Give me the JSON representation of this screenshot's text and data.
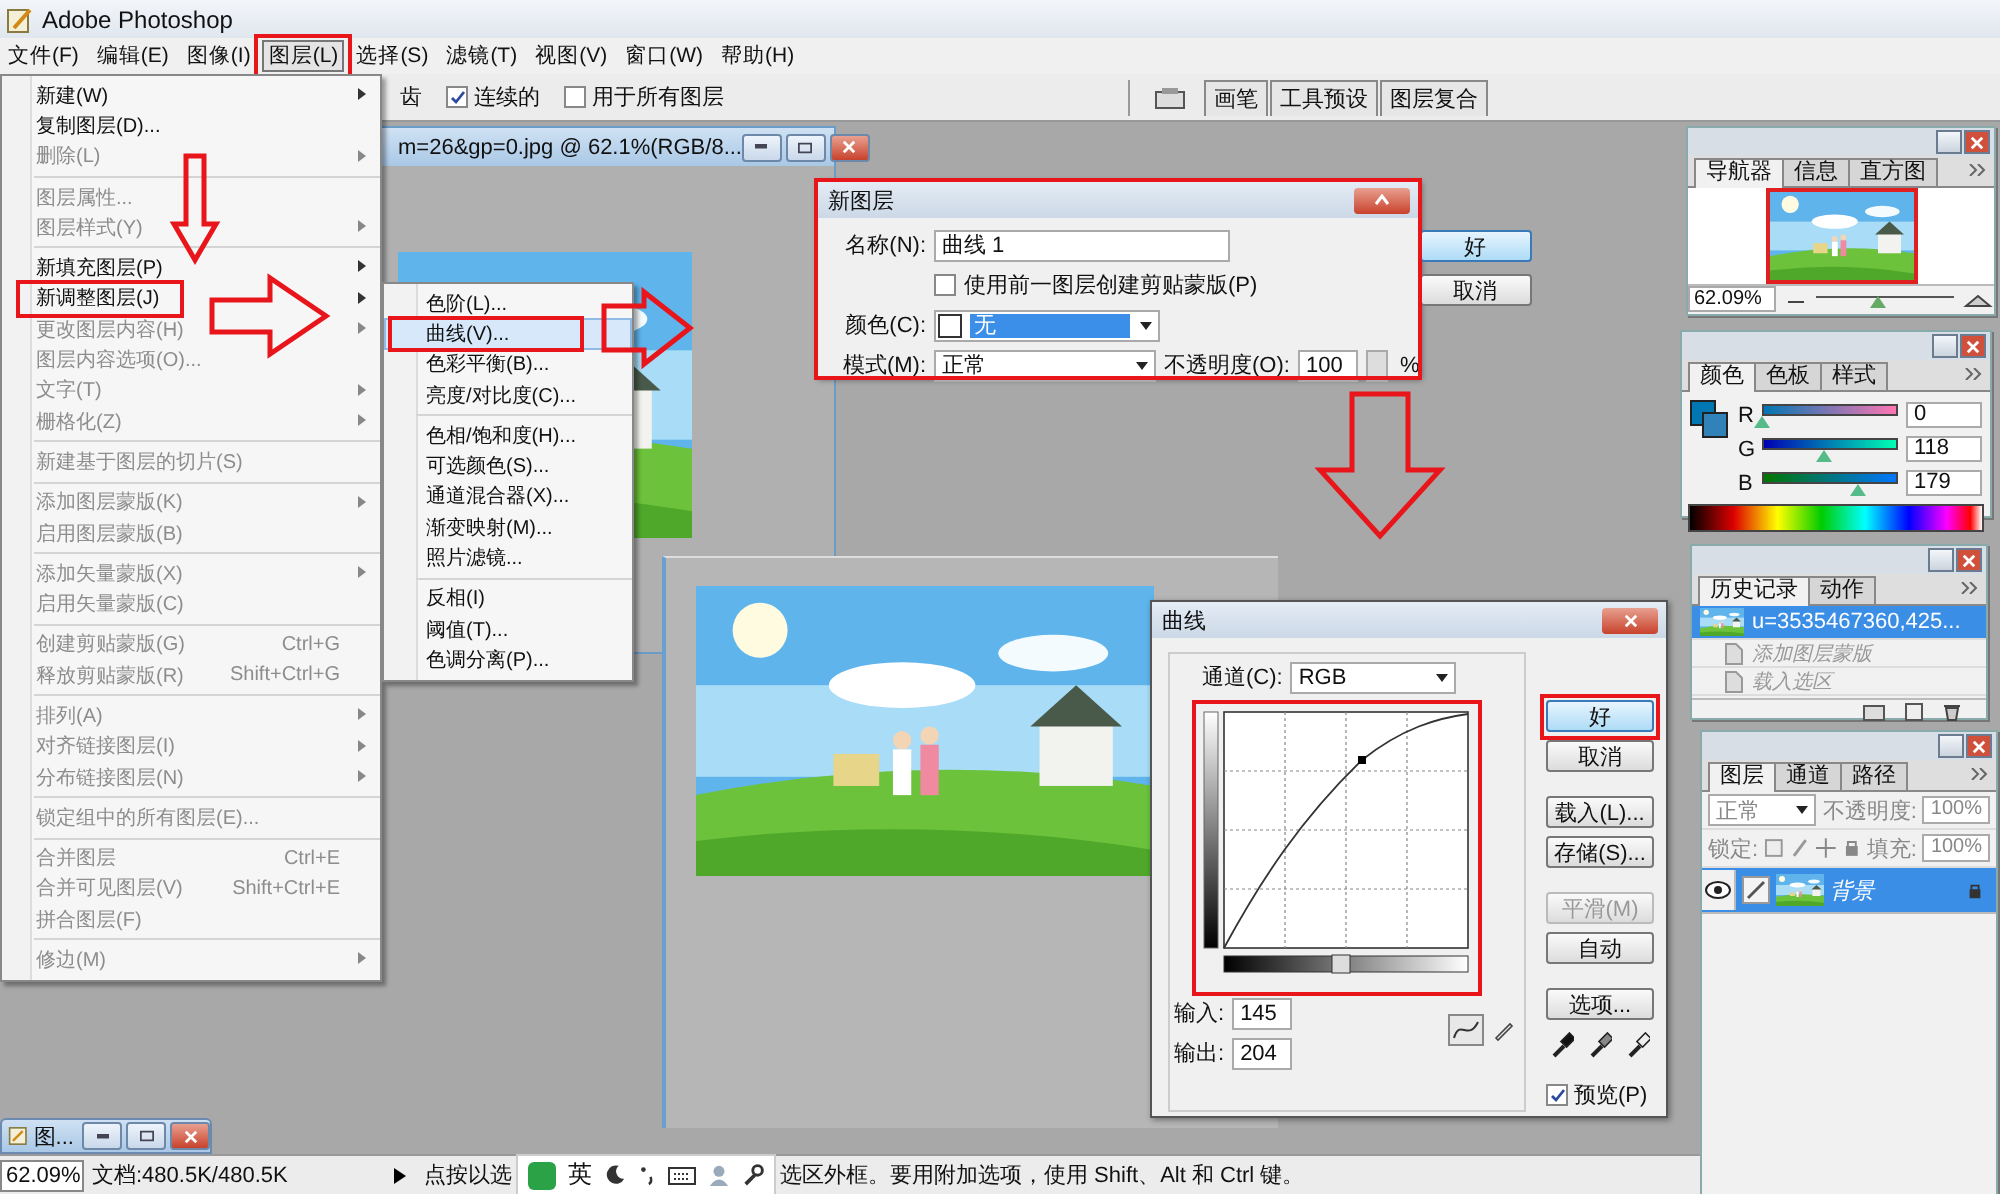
{
  "app_title": "Adobe Photoshop",
  "menu_bar": [
    {
      "label": "文件(F)",
      "selected": false,
      "marked": false
    },
    {
      "label": "编辑(E)",
      "selected": false,
      "marked": false
    },
    {
      "label": "图像(I)",
      "selected": false,
      "marked": false
    },
    {
      "label": "图层(L)",
      "selected": true,
      "marked": true
    },
    {
      "label": "选择(S)",
      "selected": false,
      "marked": false
    },
    {
      "label": "滤镜(T)",
      "selected": false,
      "marked": false
    },
    {
      "label": "视图(V)",
      "selected": false,
      "marked": false
    },
    {
      "label": "窗口(W)",
      "selected": false,
      "marked": false
    },
    {
      "label": "帮助(H)",
      "selected": false,
      "marked": false
    }
  ],
  "options_bar": {
    "cut_text": "齿",
    "checkboxes": [
      {
        "label": "连续的",
        "checked": true
      },
      {
        "label": "用于所有图层",
        "checked": false
      }
    ]
  },
  "palette_well": {
    "tabs": [
      "画笔",
      "工具预设",
      "图层复合"
    ]
  },
  "layer_menu": {
    "groups": [
      [
        {
          "label": "新建(W)",
          "disabled": false,
          "submenu": true,
          "marked": false
        },
        {
          "label": "复制图层(D)...",
          "disabled": false,
          "submenu": false,
          "marked": false
        },
        {
          "label": "删除(L)",
          "disabled": true,
          "submenu": true,
          "marked": false
        }
      ],
      [
        {
          "label": "图层属性...",
          "disabled": true,
          "submenu": false,
          "marked": false
        },
        {
          "label": "图层样式(Y)",
          "disabled": true,
          "submenu": true,
          "marked": false
        }
      ],
      [
        {
          "label": "新填充图层(P)",
          "disabled": false,
          "submenu": true,
          "marked": false
        },
        {
          "label": "新调整图层(J)",
          "disabled": false,
          "submenu": true,
          "marked": true
        },
        {
          "label": "更改图层内容(H)",
          "disabled": true,
          "submenu": true,
          "marked": false
        },
        {
          "label": "图层内容选项(O)...",
          "disabled": true,
          "submenu": false,
          "marked": false
        },
        {
          "label": "文字(T)",
          "disabled": true,
          "submenu": true,
          "marked": false
        },
        {
          "label": "栅格化(Z)",
          "disabled": true,
          "submenu": true,
          "marked": false
        }
      ],
      [
        {
          "label": "新建基于图层的切片(S)",
          "disabled": true,
          "submenu": false,
          "marked": false
        }
      ],
      [
        {
          "label": "添加图层蒙版(K)",
          "disabled": true,
          "submenu": true,
          "marked": false
        },
        {
          "label": "启用图层蒙版(B)",
          "disabled": true,
          "submenu": false,
          "marked": false
        }
      ],
      [
        {
          "label": "添加矢量蒙版(X)",
          "disabled": true,
          "submenu": true,
          "marked": false
        },
        {
          "label": "启用矢量蒙版(C)",
          "disabled": true,
          "submenu": false,
          "marked": false
        }
      ],
      [
        {
          "label": "创建剪贴蒙版(G)",
          "shortcut": "Ctrl+G",
          "disabled": true,
          "submenu": false,
          "marked": false
        },
        {
          "label": "释放剪贴蒙版(R)",
          "shortcut": "Shift+Ctrl+G",
          "disabled": true,
          "submenu": false,
          "marked": false
        }
      ],
      [
        {
          "label": "排列(A)",
          "disabled": true,
          "submenu": true,
          "marked": false
        },
        {
          "label": "对齐链接图层(I)",
          "disabled": true,
          "submenu": true,
          "marked": false
        },
        {
          "label": "分布链接图层(N)",
          "disabled": true,
          "submenu": true,
          "marked": false
        }
      ],
      [
        {
          "label": "锁定组中的所有图层(E)...",
          "disabled": true,
          "submenu": false,
          "marked": false
        }
      ],
      [
        {
          "label": "合并图层",
          "shortcut": "Ctrl+E",
          "disabled": true,
          "submenu": false,
          "marked": false
        },
        {
          "label": "合并可见图层(V)",
          "shortcut": "Shift+Ctrl+E",
          "disabled": true,
          "submenu": false,
          "marked": false
        },
        {
          "label": "拼合图层(F)",
          "disabled": true,
          "submenu": false,
          "marked": false
        }
      ],
      [
        {
          "label": "修边(M)",
          "disabled": true,
          "submenu": true,
          "marked": false
        }
      ]
    ]
  },
  "adjustment_submenu": {
    "groups": [
      [
        {
          "label": "色阶(L)...",
          "selected": false,
          "marked": false
        },
        {
          "label": "曲线(V)...",
          "selected": true,
          "marked": true
        },
        {
          "label": "色彩平衡(B)...",
          "selected": false,
          "marked": false
        },
        {
          "label": "亮度/对比度(C)...",
          "selected": false,
          "marked": false
        }
      ],
      [
        {
          "label": "色相/饱和度(H)...",
          "selected": false,
          "marked": false
        },
        {
          "label": "可选颜色(S)...",
          "selected": false,
          "marked": false
        },
        {
          "label": "通道混合器(X)...",
          "selected": false,
          "marked": false
        },
        {
          "label": "渐变映射(M)...",
          "selected": false,
          "marked": false
        },
        {
          "label": "照片滤镜...",
          "selected": false,
          "marked": false
        }
      ],
      [
        {
          "label": "反相(I)",
          "selected": false,
          "marked": false
        },
        {
          "label": "阈值(T)...",
          "selected": false,
          "marked": false
        },
        {
          "label": "色调分离(P)...",
          "selected": false,
          "marked": false
        }
      ]
    ]
  },
  "document_window": {
    "title": "m=26&gp=0.jpg @ 62.1%(RGB/8..."
  },
  "new_layer_dialog": {
    "title": "新图层",
    "marked": true,
    "name_label": "名称(N):",
    "name_value": "曲线 1",
    "clip_label": "使用前一图层创建剪贴蒙版(P)",
    "clip_checked": false,
    "color_label": "颜色(C):",
    "color_value": "无",
    "mode_label": "模式(M):",
    "mode_value": "正常",
    "opacity_label": "不透明度(O):",
    "opacity_value": "100",
    "opacity_unit": "%",
    "buttons": [
      "好",
      "取消"
    ]
  },
  "curves_dialog": {
    "title": "曲线",
    "graph_marked": true,
    "channel_label": "通道(C):",
    "channel_value": "RGB",
    "input_label": "输入:",
    "input_value": "145",
    "output_label": "输出:",
    "output_value": "204",
    "preview_label": "预览(P)",
    "preview_checked": true,
    "buttons": [
      {
        "label": "好",
        "disabled": false,
        "marked": true
      },
      {
        "label": "取消",
        "disabled": false,
        "marked": false
      },
      {
        "label": "载入(L)...",
        "disabled": false,
        "marked": false
      },
      {
        "label": "存储(S)...",
        "disabled": false,
        "marked": false
      },
      {
        "label": "平滑(M)",
        "disabled": true,
        "marked": false
      },
      {
        "label": "自动",
        "disabled": false,
        "marked": false
      },
      {
        "label": "选项...",
        "disabled": false,
        "marked": false
      }
    ]
  },
  "navigator_panel": {
    "tabs": [
      {
        "label": "导航器",
        "selected": true
      },
      {
        "label": "信息",
        "selected": false
      },
      {
        "label": "直方图",
        "selected": false
      }
    ],
    "zoom": "62.09%",
    "zoom_slider": {
      "level": 0.45
    }
  },
  "color_panel": {
    "tabs": [
      {
        "label": "颜色",
        "selected": true
      },
      {
        "label": "色板",
        "selected": false
      },
      {
        "label": "样式",
        "selected": false
      }
    ],
    "channels": [
      {
        "name": "R",
        "value": "0",
        "level": 0
      },
      {
        "name": "G",
        "value": "118",
        "level": 0.46
      },
      {
        "name": "B",
        "value": "179",
        "level": 0.7
      }
    ]
  },
  "history_panel": {
    "tabs": [
      {
        "label": "历史记录",
        "selected": true
      },
      {
        "label": "动作",
        "selected": false
      }
    ],
    "items": [
      {
        "label": "u=3535467360,425...",
        "selected": true
      },
      {
        "label": "添加图层蒙版",
        "selected": false
      },
      {
        "label": "载入选区",
        "selected": false
      }
    ]
  },
  "layers_panel": {
    "tabs": [
      {
        "label": "图层",
        "selected": true
      },
      {
        "label": "通道",
        "selected": false
      },
      {
        "label": "路径",
        "selected": false
      }
    ],
    "blend_mode": "正常",
    "opacity_label": "不透明度:",
    "opacity": "100%",
    "lock_label": "锁定:",
    "fill_label": "填充:",
    "fill": "100%",
    "layers": [
      {
        "name": "背景",
        "selected": true,
        "visible": true
      }
    ]
  },
  "minimized_window": {
    "title": "图..."
  },
  "status_bar": {
    "zoom": "62.09%",
    "document": "文档:480.5K/480.5K",
    "message_start": "点按以选",
    "message_end": "选区外框。要用附加选项，使用 Shift、Alt 和 Ctrl 键。"
  },
  "ime_toolbar": {
    "mode": "英"
  }
}
